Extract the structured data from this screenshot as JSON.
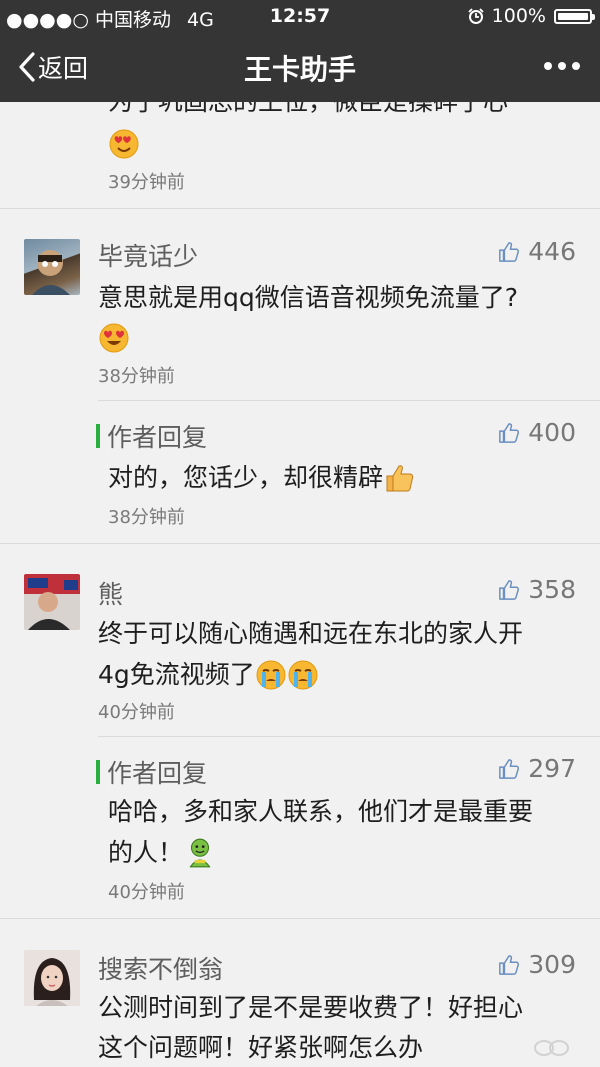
{
  "status_bar": {
    "signal": "●●●●○",
    "carrier": "中国移动",
    "network": "4G",
    "time": "12:57",
    "battery": "100%"
  },
  "nav": {
    "back_label": "返回",
    "title": "王卡助手"
  },
  "partial_comment": {
    "text": "为了巩固总的王位，微臣是操碎了心",
    "time": "39分钟前"
  },
  "comments": [
    {
      "author": "毕竟话少",
      "likes": "446",
      "line1": "意思就是用qq微信语音视频免流量了?",
      "line2": "",
      "time": "38分钟前",
      "reply": {
        "label": "作者回复",
        "likes": "400",
        "line1": "对的，您话少，却很精辟",
        "line2": "",
        "time": "38分钟前"
      }
    },
    {
      "author": "熊",
      "likes": "358",
      "line1": "终于可以随心随遇和远在东北的家人开",
      "line2": "4g免流视频了",
      "time": "40分钟前",
      "reply": {
        "label": "作者回复",
        "likes": "297",
        "line1": "哈哈，多和家人联系，他们才是最重要",
        "line2": "的人！",
        "time": "40分钟前"
      }
    },
    {
      "author": "搜索不倒翁",
      "likes": "309",
      "line1": "公测时间到了是不是要收费了！好担心",
      "line2": "这个问题啊！好紧张啊怎么办",
      "time": "",
      "reply": null
    }
  ],
  "colors": {
    "header_bg": "#353535",
    "page_bg": "#f1f1f1",
    "author_reply_bar": "#2aae3e"
  }
}
